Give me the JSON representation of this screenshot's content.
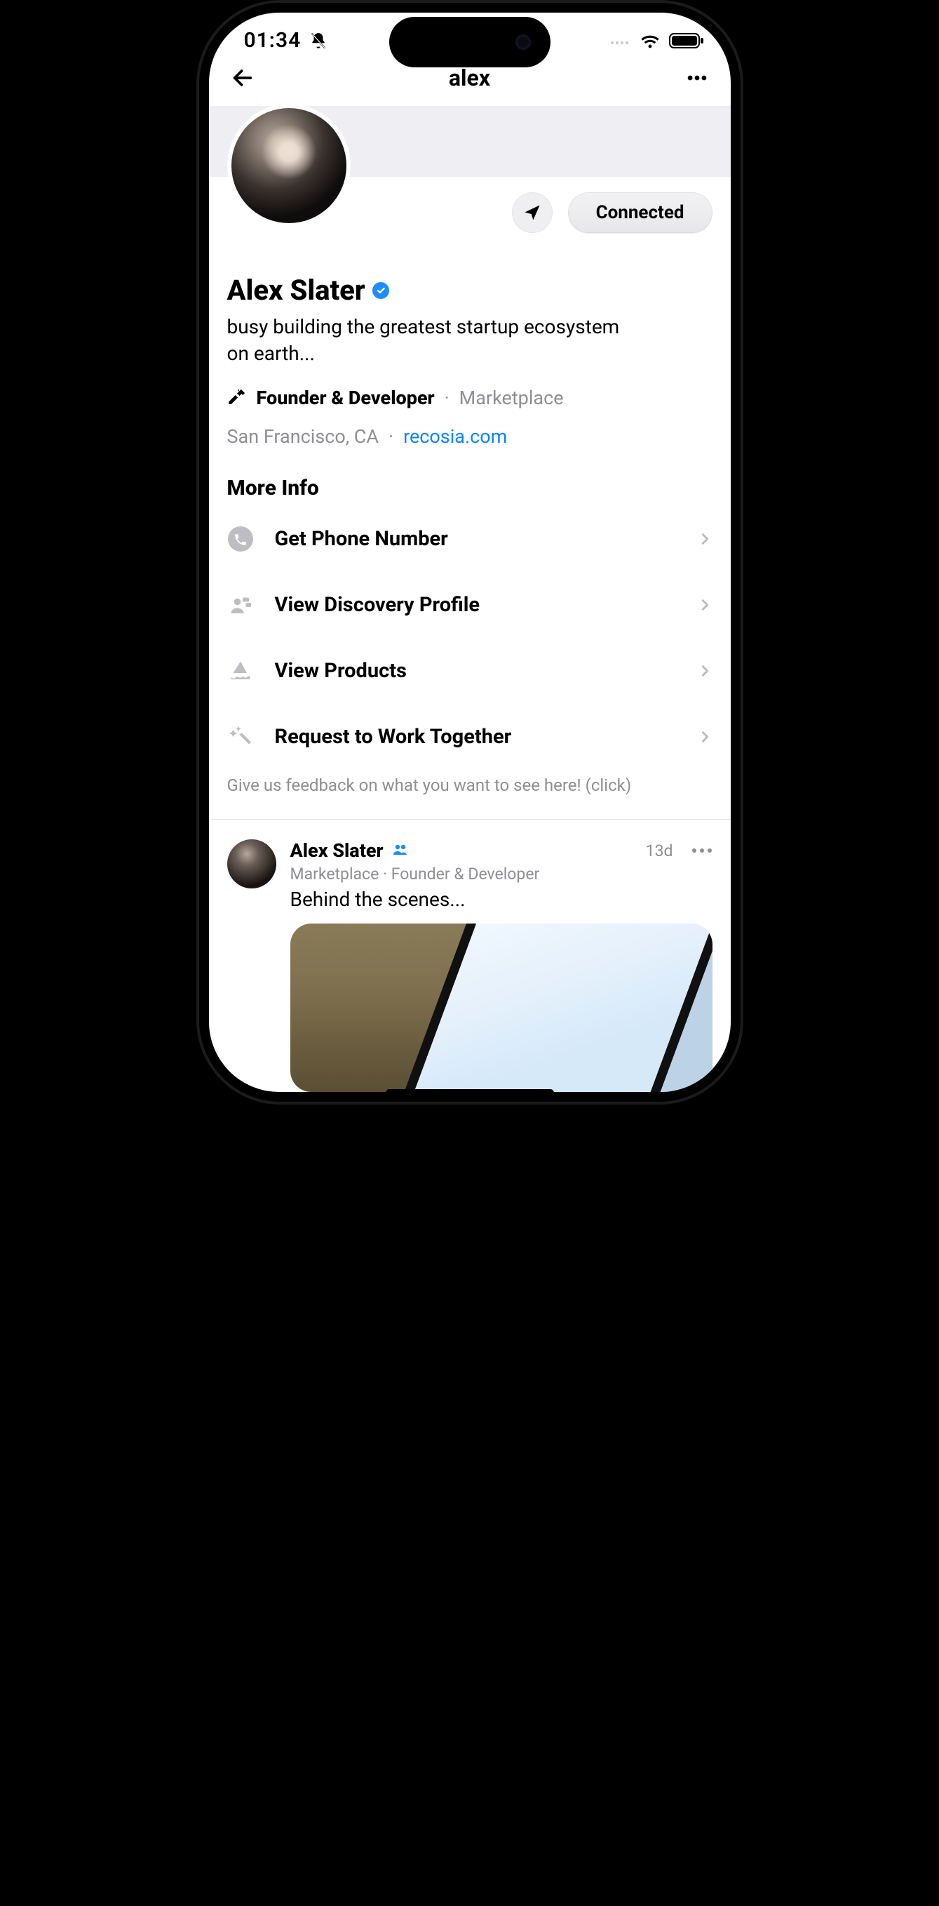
{
  "status": {
    "time": "01:34"
  },
  "nav": {
    "title": "alex"
  },
  "actions": {
    "connected_label": "Connected"
  },
  "profile": {
    "name": "Alex Slater",
    "bio": "busy building the greatest startup ecosystem on earth...",
    "role": "Founder & Developer",
    "company": "Marketplace",
    "location": "San Francisco, CA",
    "website": "recosia.com"
  },
  "more_info": {
    "title": "More Info",
    "items": [
      {
        "label": "Get Phone Number",
        "icon": "phone"
      },
      {
        "label": "View Discovery Profile",
        "icon": "people"
      },
      {
        "label": "View Products",
        "icon": "boat"
      },
      {
        "label": "Request to Work Together",
        "icon": "wand"
      }
    ],
    "feedback": "Give us feedback on what you want to see here! (click)"
  },
  "post": {
    "author": "Alex Slater",
    "meta": "Marketplace · Founder & Developer",
    "time": "13d",
    "text": "Behind the scenes..."
  }
}
